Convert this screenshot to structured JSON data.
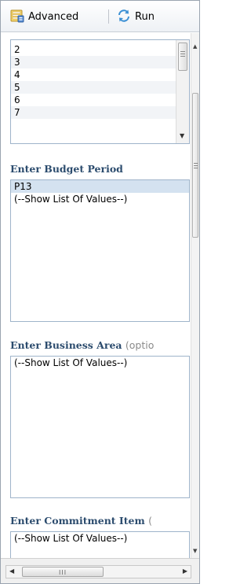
{
  "toolbar": {
    "advanced_label": "Advanced",
    "run_label": "Run"
  },
  "top_list": {
    "items": [
      "2",
      "3",
      "4",
      "5",
      "6",
      "7"
    ]
  },
  "budget_period": {
    "title": "Enter Budget Period",
    "options": [
      "P13",
      "(--Show List Of Values--)"
    ],
    "selected": "P13"
  },
  "business_area": {
    "title": "Enter Business Area",
    "suffix": "(optio",
    "options": [
      "(--Show List Of Values--)"
    ]
  },
  "commitment_item": {
    "title": "Enter Commitment Item",
    "suffix": "(",
    "options": [
      "(--Show List Of Values--)"
    ]
  },
  "colors": {
    "section_title": "#2c4c6e",
    "selected_row": "#d4e2f0",
    "listbox_border": "#9fb4ca"
  },
  "icons": {
    "advanced": "advanced-options-icon",
    "run": "run-refresh-icon"
  }
}
